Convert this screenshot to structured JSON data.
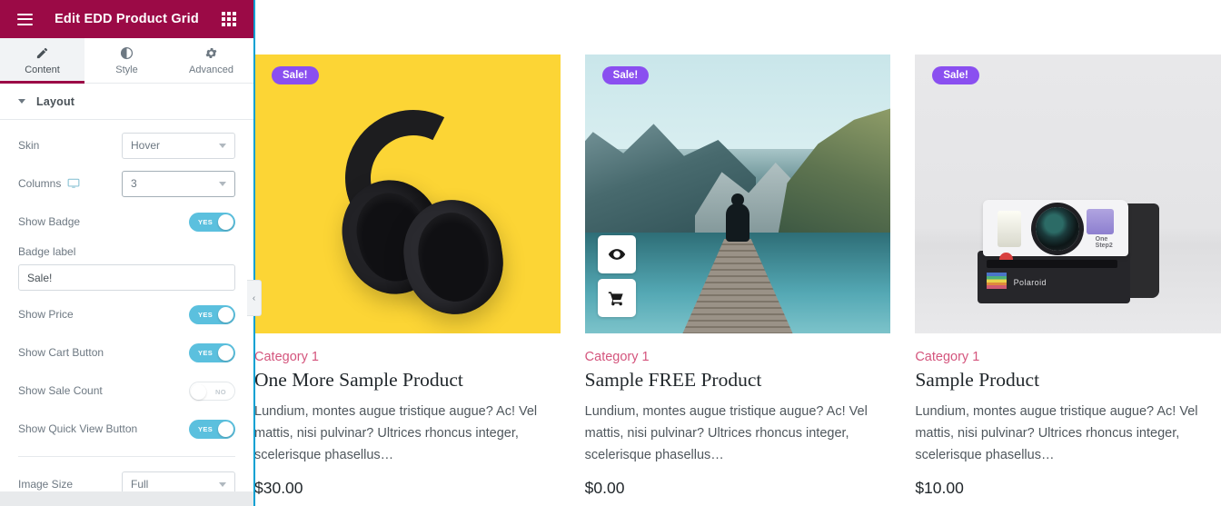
{
  "panel": {
    "header": {
      "title": "Edit EDD Product Grid",
      "menu_icon": "hamburger-icon",
      "grid_icon": "apps-grid-icon",
      "bg_color": "#9b0a46"
    },
    "tabs": [
      {
        "label": "Content",
        "icon": "pencil-icon",
        "active": true
      },
      {
        "label": "Style",
        "icon": "contrast-circle-icon",
        "active": false
      },
      {
        "label": "Advanced",
        "icon": "gear-icon",
        "active": false
      }
    ],
    "section": {
      "title": "Layout",
      "collapsed": false
    },
    "controls": {
      "skin": {
        "label": "Skin",
        "value": "Hover"
      },
      "columns": {
        "label": "Columns",
        "value": "3",
        "device_icon": "desktop-monitor-icon"
      },
      "show_badge": {
        "label": "Show Badge",
        "state": "YES",
        "on": true
      },
      "badge_label": {
        "label": "Badge label",
        "value": "Sale!",
        "placeholder": "Sale!"
      },
      "show_price": {
        "label": "Show Price",
        "state": "YES",
        "on": true
      },
      "show_cart_button": {
        "label": "Show Cart Button",
        "state": "YES",
        "on": true
      },
      "show_sale_count": {
        "label": "Show Sale Count",
        "state": "NO",
        "on": false
      },
      "show_quick_view_button": {
        "label": "Show Quick View Button",
        "state": "YES",
        "on": true
      },
      "image_size": {
        "label": "Image Size",
        "value": "Full"
      }
    },
    "collapse_tab": {
      "icon": "chevron-left-icon",
      "glyph": "‹"
    },
    "accent_color": "#5bc0de"
  },
  "canvas": {
    "edit_boundary_color": "#00a0d2",
    "products": [
      {
        "badge": "Sale!",
        "category": "Category 1",
        "title": "One More Sample Product",
        "description": "Lundium, montes augue tristique augue? Ac! Vel mattis, nisi pulvinar? Ultrices rhoncus integer, scelerisque phasellus…",
        "price": "$30.00",
        "image": "yellow-headphones-photo",
        "hover_buttons": []
      },
      {
        "badge": "Sale!",
        "category": "Category 1",
        "title": "Sample FREE Product",
        "description": "Lundium, montes augue tristique augue? Ac! Vel mattis, nisi pulvinar? Ultrices rhoncus integer, scelerisque phasellus…",
        "price": "$0.00",
        "image": "mountain-lake-dock-photo",
        "hover_buttons": [
          {
            "icon": "eye-icon",
            "name": "quick-view-button"
          },
          {
            "icon": "shopping-cart-icon",
            "name": "add-to-cart-button"
          }
        ]
      },
      {
        "badge": "Sale!",
        "category": "Category 1",
        "title": "Sample Product",
        "description": "Lundium, montes augue tristique augue? Ac! Vel mattis, nisi pulvinar? Ultrices rhoncus integer, scelerisque phasellus…",
        "price": "$10.00",
        "image": "polaroid-camera-photo",
        "hover_buttons": []
      }
    ],
    "badge_color": "#8a4ff0",
    "category_color": "#d4557d"
  }
}
